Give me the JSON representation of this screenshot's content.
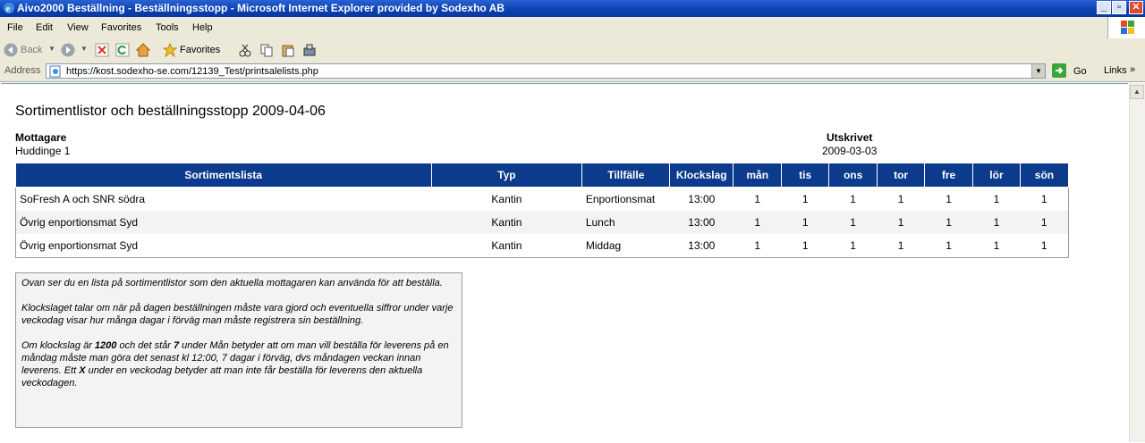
{
  "window": {
    "title": "Aivo2000 Beställning - Beställningsstopp - Microsoft Internet Explorer provided by Sodexho AB",
    "min_label": "_",
    "max_label": "▫",
    "close_label": "✕"
  },
  "menu": [
    "File",
    "Edit",
    "View",
    "Favorites",
    "Tools",
    "Help"
  ],
  "toolbar": {
    "back_label": "Back",
    "favorites_label": "Favorites"
  },
  "address": {
    "label": "Address",
    "url": "https://kost.sodexho-se.com/12139_Test/printsalelists.php",
    "go_label": "Go",
    "links_label": "Links"
  },
  "page": {
    "title": "Sortimentlistor och beställningsstopp 2009-04-06",
    "recipient_label": "Mottagare",
    "recipient_value": "Huddinge 1",
    "printed_label": "Utskrivet",
    "printed_value": "2009-03-03"
  },
  "table": {
    "headers": [
      "Sortimentslista",
      "Typ",
      "Tillfälle",
      "Klockslag",
      "mån",
      "tis",
      "ons",
      "tor",
      "fre",
      "lör",
      "sön"
    ],
    "rows": [
      [
        "SoFresh A och SNR södra",
        "Kantin",
        "Enportionsmat",
        "13:00",
        "1",
        "1",
        "1",
        "1",
        "1",
        "1",
        "1"
      ],
      [
        "Övrig enportionsmat Syd",
        "Kantin",
        "Lunch",
        "13:00",
        "1",
        "1",
        "1",
        "1",
        "1",
        "1",
        "1"
      ],
      [
        "Övrig enportionsmat Syd",
        "Kantin",
        "Middag",
        "13:00",
        "1",
        "1",
        "1",
        "1",
        "1",
        "1",
        "1"
      ]
    ]
  },
  "note": {
    "p1": "Ovan ser du en lista på sortimentlistor som den aktuella mottagaren kan använda för att beställa.",
    "p2": "Klockslaget talar om när på dagen beställningen måste vara gjord och eventuella siffror under varje veckodag visar hur många dagar i förväg man måste registrera sin beställning.",
    "p3a": "Om klockslag är ",
    "p3b": "1200",
    "p3c": " och det står ",
    "p3d": "7",
    "p3e": " under Mån betyder att om man vill beställa för leverens på en måndag måste man göra det senast kl 12:00, 7 dagar i förväg, dvs måndagen veckan innan leverens. Ett ",
    "p3f": "X",
    "p3g": " under en veckodag betyder att man inte får beställa för leverens den aktuella veckodagen."
  },
  "colors": {
    "header_bg": "#0c3a8c",
    "titlebar": "#0a3fb0"
  }
}
